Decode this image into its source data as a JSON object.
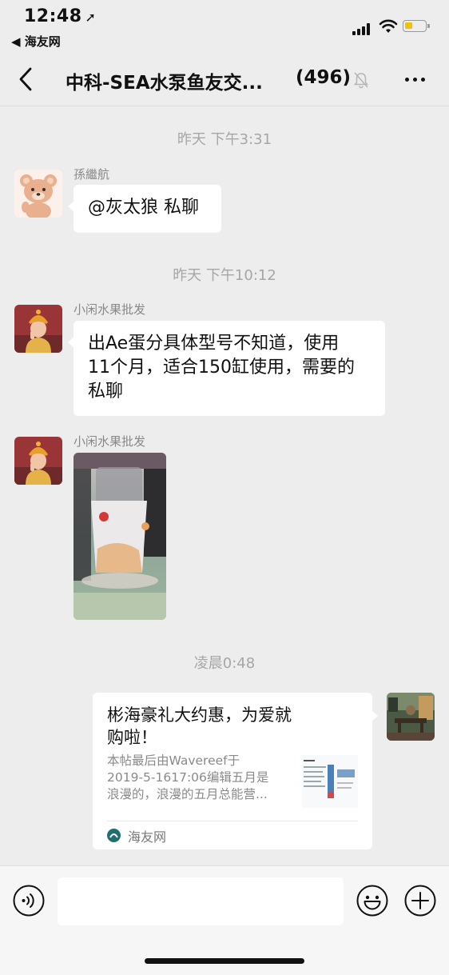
{
  "status_bar": {
    "time": "12:48",
    "back_app": "◀ 海友网"
  },
  "nav": {
    "title": "中科-SEA水泵鱼友交...",
    "member_count": "(496)"
  },
  "messages": [
    {
      "timestamp": "昨天 下午3:31"
    },
    {
      "sender": "孫繼航",
      "text": "@灰太狼 私聊"
    },
    {
      "timestamp": "昨天 下午10:12"
    },
    {
      "sender": "小闲水果批发",
      "text_lines": [
        "出Ae蛋分具体型号不知道，使用",
        "11个月，适合150缸使用，需要的",
        "私聊"
      ]
    },
    {
      "sender": "小闲水果批发",
      "type": "image"
    },
    {
      "timestamp": "凌晨0:48"
    },
    {
      "type": "link_card",
      "title_lines": [
        "彬海豪礼大约惠，为爱就",
        "购啦！"
      ],
      "desc_lines": [
        "本帖最后由Wavereef于",
        "2019-5-1617:06编辑五月是",
        "浪漫的，浪漫的五月总能营..."
      ],
      "source": "海友网"
    }
  ],
  "input": {
    "value": "",
    "placeholder": ""
  }
}
